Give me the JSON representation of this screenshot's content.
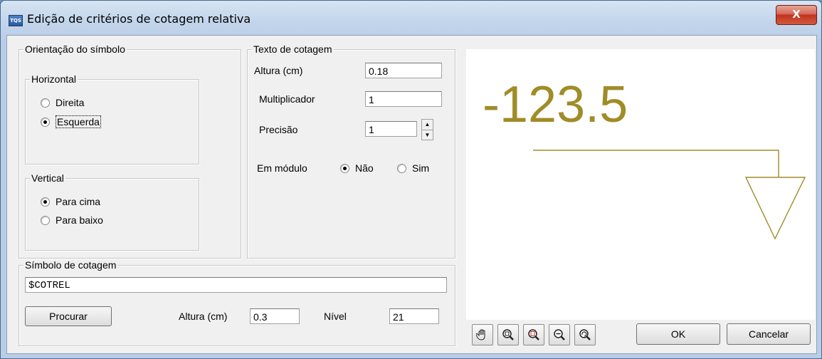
{
  "window": {
    "title": "Edição de critérios de cotagem relativa",
    "close_glyph": "X",
    "icon_text": "TQS"
  },
  "orientation": {
    "legend": "Orientação do símbolo",
    "horizontal": {
      "legend": "Horizontal",
      "opt1": "Direita",
      "opt2": "Esquerda",
      "selected": "Esquerda"
    },
    "vertical": {
      "legend": "Vertical",
      "opt1": "Para cima",
      "opt2": "Para baixo",
      "selected": "Para cima"
    }
  },
  "texto": {
    "legend": "Texto de cotagem",
    "altura_label": "Altura (cm)",
    "altura_value": "0.18",
    "mult_label": "Multiplicador",
    "mult_value": "1",
    "precisao_label": "Precisão",
    "precisao_value": "1",
    "modulo_label": "Em módulo",
    "nao": "Não",
    "sim": "Sim",
    "selected": "Não"
  },
  "simbolo": {
    "legend": "Símbolo de cotagem",
    "name_value": "$COTREL",
    "procurar": "Procurar",
    "altura_label": "Altura (cm)",
    "altura_value": "0.3",
    "nivel_label": "Nível",
    "nivel_value": "21"
  },
  "preview": {
    "value_text": "-123.5",
    "color": "#a08c28"
  },
  "toolbar": {
    "icons": [
      "pan-icon",
      "zoom-window-icon",
      "zoom-extents-icon",
      "zoom-out-icon",
      "refresh-zoom-icon"
    ]
  },
  "buttons": {
    "ok": "OK",
    "cancel": "Cancelar"
  }
}
